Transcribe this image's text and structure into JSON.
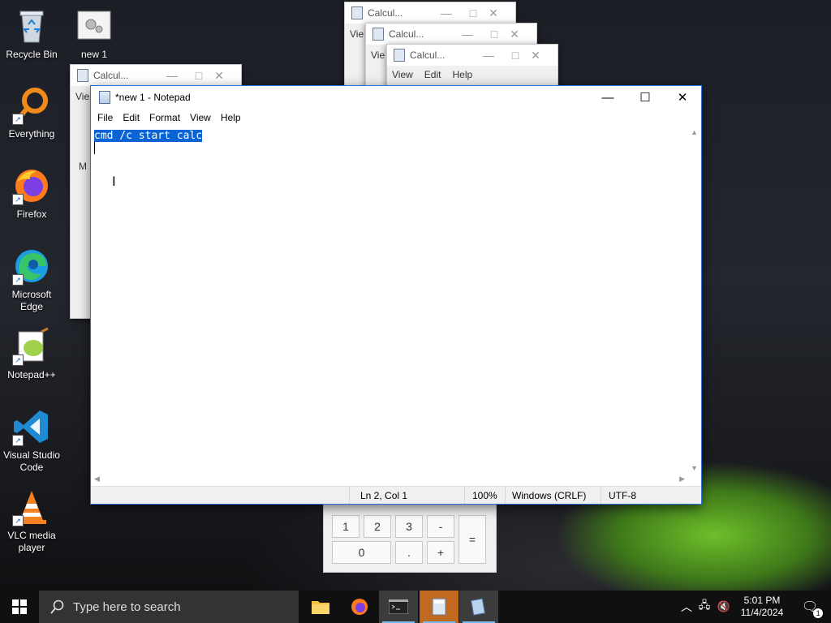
{
  "desktop": {
    "icons": [
      {
        "label": "Recycle Bin"
      },
      {
        "label": "new 1"
      },
      {
        "label": "Everything"
      },
      {
        "label": "Firefox"
      },
      {
        "label": "Microsoft Edge"
      },
      {
        "label": "Notepad++"
      },
      {
        "label": "Visual Studio Code"
      },
      {
        "label": "VLC media player"
      }
    ]
  },
  "calc_windows": {
    "title": "Calcul...",
    "menu_view": "View",
    "menu_edit": "Edit",
    "menu_help": "Help",
    "view_short": "Vie",
    "m_short": "M"
  },
  "calc_keys": {
    "k1": "1",
    "k2": "2",
    "k3": "3",
    "minus": "-",
    "equals": "=",
    "k0": "0",
    "dot": ".",
    "plus": "+"
  },
  "notepad": {
    "title": "*new 1 - Notepad",
    "menu": [
      "File",
      "Edit",
      "Format",
      "View",
      "Help"
    ],
    "content_selected": "cmd /c start calc",
    "status": {
      "position": "Ln 2, Col 1",
      "zoom": "100%",
      "line_ending": "Windows (CRLF)",
      "encoding": "UTF-8"
    }
  },
  "taskbar": {
    "search_placeholder": "Type here to search",
    "time": "5:01 PM",
    "date": "11/4/2024",
    "notification_count": "1"
  },
  "colors": {
    "selection": "#0a64d6",
    "taskbar": "#101010",
    "active_app": "#c06a21"
  }
}
